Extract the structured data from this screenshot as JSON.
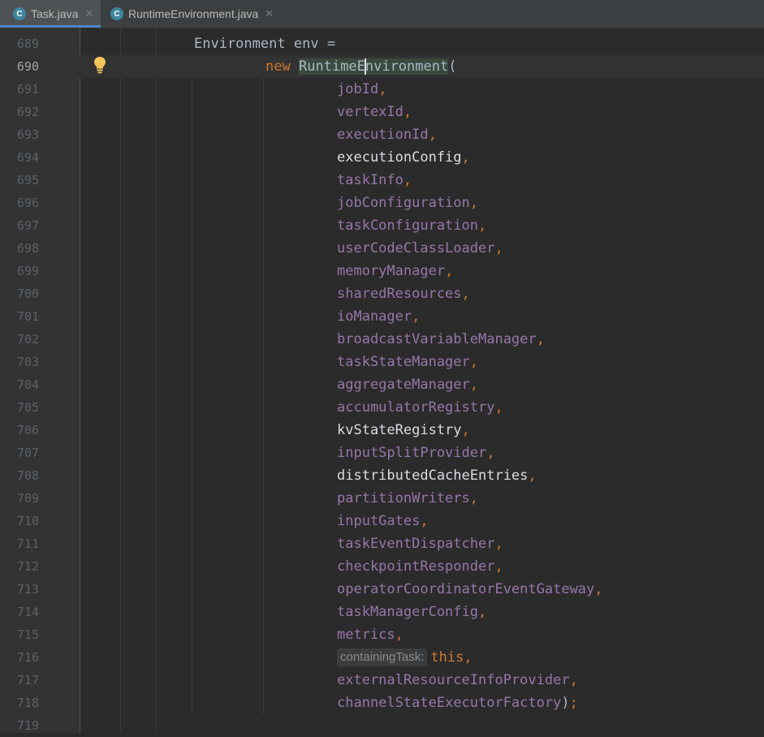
{
  "tabs": [
    {
      "name": "Task.java",
      "icon": "C",
      "active": true
    },
    {
      "name": "RuntimeEnvironment.java",
      "icon": "C",
      "active": false
    }
  ],
  "code": {
    "line_689": {
      "num": "689",
      "type": "Environment",
      "name": "env",
      "op": "="
    },
    "line_690": {
      "num": "690",
      "kw": "new",
      "ctor_a": "RuntimeE",
      "ctor_b": "nvironment",
      "paren": "("
    },
    "args": [
      {
        "num": "691",
        "name": "jobId",
        "sep": ",",
        "style": "var"
      },
      {
        "num": "692",
        "name": "vertexId",
        "sep": ",",
        "style": "var"
      },
      {
        "num": "693",
        "name": "executionId",
        "sep": ",",
        "style": "var"
      },
      {
        "num": "694",
        "name": "executionConfig",
        "sep": ",",
        "style": "light"
      },
      {
        "num": "695",
        "name": "taskInfo",
        "sep": ",",
        "style": "var"
      },
      {
        "num": "696",
        "name": "jobConfiguration",
        "sep": ",",
        "style": "var"
      },
      {
        "num": "697",
        "name": "taskConfiguration",
        "sep": ",",
        "style": "var"
      },
      {
        "num": "698",
        "name": "userCodeClassLoader",
        "sep": ",",
        "style": "var"
      },
      {
        "num": "699",
        "name": "memoryManager",
        "sep": ",",
        "style": "var"
      },
      {
        "num": "700",
        "name": "sharedResources",
        "sep": ",",
        "style": "var"
      },
      {
        "num": "701",
        "name": "ioManager",
        "sep": ",",
        "style": "var"
      },
      {
        "num": "702",
        "name": "broadcastVariableManager",
        "sep": ",",
        "style": "var"
      },
      {
        "num": "703",
        "name": "taskStateManager",
        "sep": ",",
        "style": "var"
      },
      {
        "num": "704",
        "name": "aggregateManager",
        "sep": ",",
        "style": "var"
      },
      {
        "num": "705",
        "name": "accumulatorRegistry",
        "sep": ",",
        "style": "var"
      },
      {
        "num": "706",
        "name": "kvStateRegistry",
        "sep": ",",
        "style": "light"
      },
      {
        "num": "707",
        "name": "inputSplitProvider",
        "sep": ",",
        "style": "var"
      },
      {
        "num": "708",
        "name": "distributedCacheEntries",
        "sep": ",",
        "style": "light"
      },
      {
        "num": "709",
        "name": "partitionWriters",
        "sep": ",",
        "style": "var"
      },
      {
        "num": "710",
        "name": "inputGates",
        "sep": ",",
        "style": "var"
      },
      {
        "num": "711",
        "name": "taskEventDispatcher",
        "sep": ",",
        "style": "var"
      },
      {
        "num": "712",
        "name": "checkpointResponder",
        "sep": ",",
        "style": "var"
      },
      {
        "num": "713",
        "name": "operatorCoordinatorEventGateway",
        "sep": ",",
        "style": "var"
      },
      {
        "num": "714",
        "name": "taskManagerConfig",
        "sep": ",",
        "style": "var"
      },
      {
        "num": "715",
        "name": "metrics",
        "sep": ",",
        "style": "var"
      },
      {
        "num": "716",
        "hint": "containingTask:",
        "name": "this",
        "sep": ",",
        "style": "kw"
      },
      {
        "num": "717",
        "name": "externalResourceInfoProvider",
        "sep": ",",
        "style": "var"
      },
      {
        "num": "718",
        "name": "channelStateExecutorFactory",
        "sep": ");",
        "style": "var"
      }
    ],
    "line_719": {
      "num": "719"
    }
  },
  "colors": {
    "background": "#2b2b2b",
    "keyword": "#cc7832",
    "field": "#9876aa",
    "plain": "#a9b7c6",
    "tab_underline": "#4a88c7"
  },
  "icons": [
    "class-file-icon",
    "close-icon",
    "lightbulb-icon"
  ]
}
